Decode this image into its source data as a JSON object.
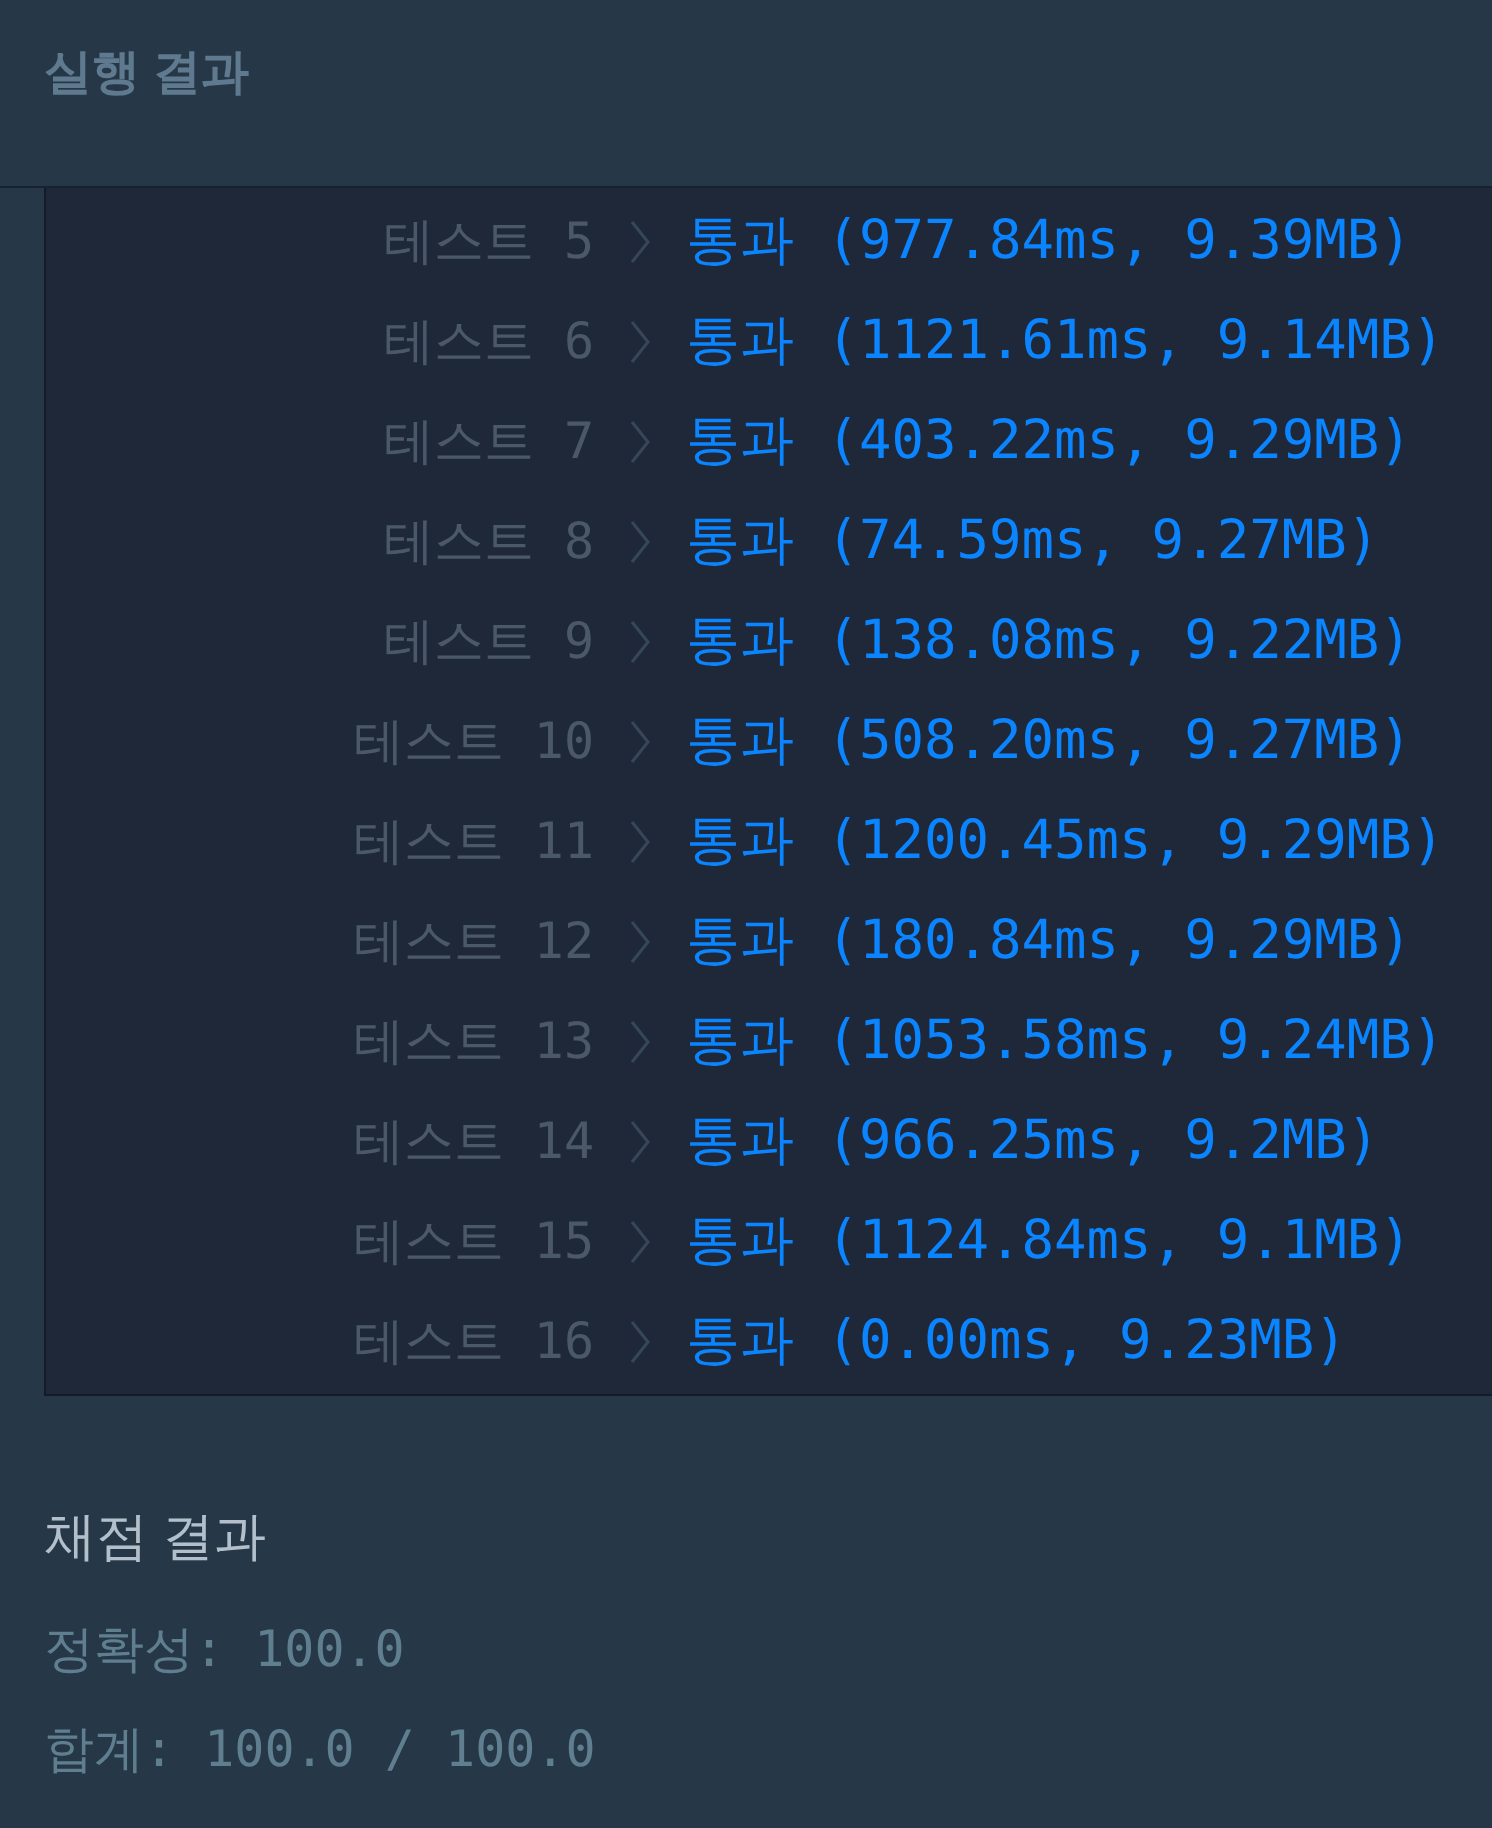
{
  "section_title": "실행 결과",
  "tests": [
    {
      "label": "테스트 5",
      "result": "통과 (977.84ms, 9.39MB)"
    },
    {
      "label": "테스트 6",
      "result": "통과 (1121.61ms, 9.14MB)"
    },
    {
      "label": "테스트 7",
      "result": "통과 (403.22ms, 9.29MB)"
    },
    {
      "label": "테스트 8",
      "result": "통과 (74.59ms, 9.27MB)"
    },
    {
      "label": "테스트 9",
      "result": "통과 (138.08ms, 9.22MB)"
    },
    {
      "label": "테스트 10",
      "result": "통과 (508.20ms, 9.27MB)"
    },
    {
      "label": "테스트 11",
      "result": "통과 (1200.45ms, 9.29MB)"
    },
    {
      "label": "테스트 12",
      "result": "통과 (180.84ms, 9.29MB)"
    },
    {
      "label": "테스트 13",
      "result": "통과 (1053.58ms, 9.24MB)"
    },
    {
      "label": "테스트 14",
      "result": "통과 (966.25ms, 9.2MB)"
    },
    {
      "label": "테스트 15",
      "result": "통과 (1124.84ms, 9.1MB)"
    },
    {
      "label": "테스트 16",
      "result": "통과 (0.00ms, 9.23MB)"
    }
  ],
  "grading": {
    "title": "채점 결과",
    "lines": [
      "정확성: 100.0",
      "합계: 100.0 / 100.0"
    ]
  }
}
